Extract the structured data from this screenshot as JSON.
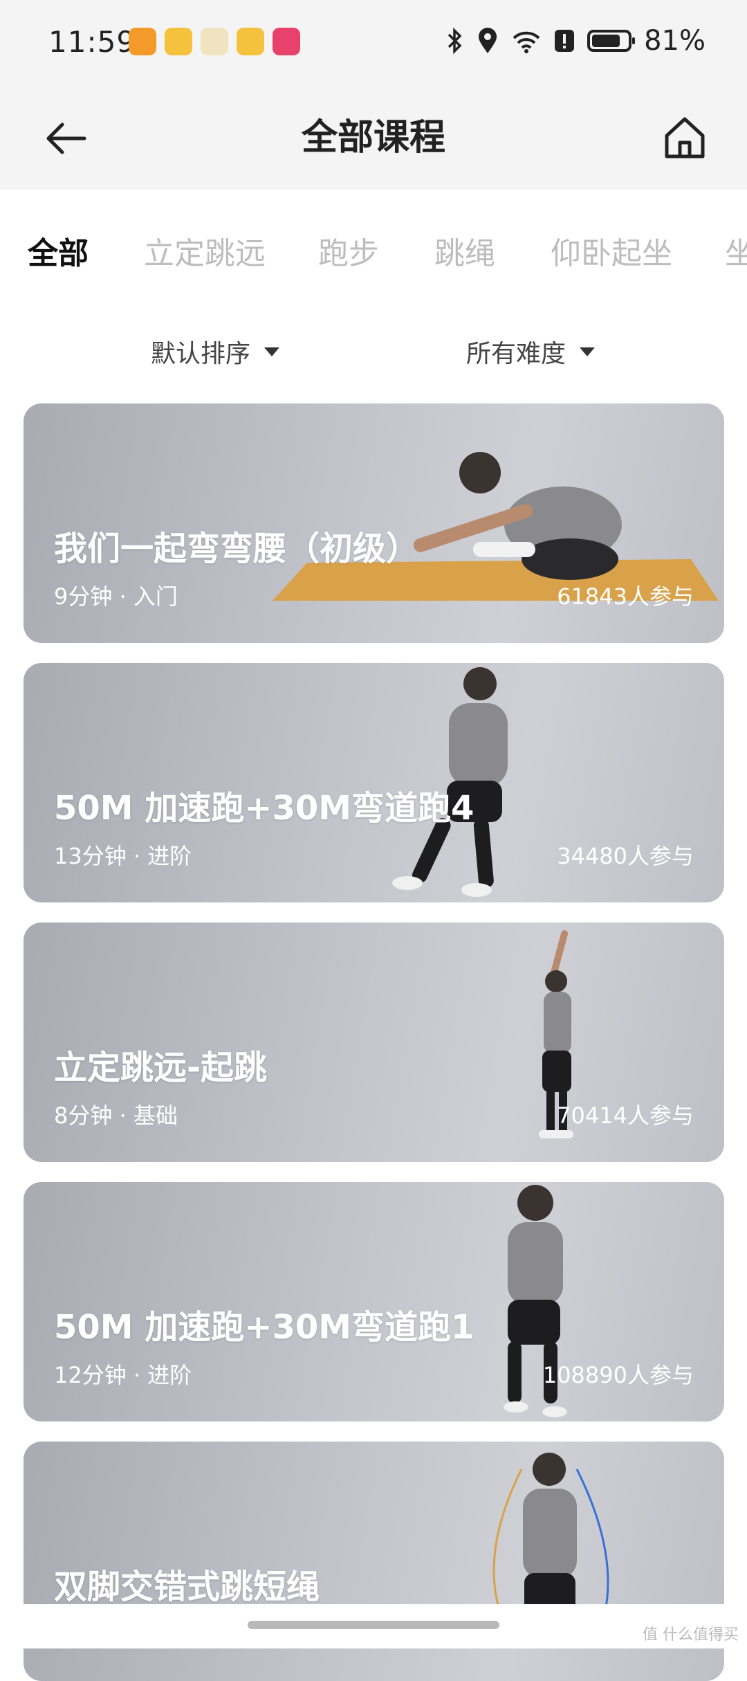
{
  "status": {
    "time": "11:59",
    "battery": "81%"
  },
  "header": {
    "title": "全部课程"
  },
  "tabs": [
    {
      "label": "全部",
      "active": true
    },
    {
      "label": "立定跳远",
      "active": false
    },
    {
      "label": "跑步",
      "active": false
    },
    {
      "label": "跳绳",
      "active": false
    },
    {
      "label": "仰卧起坐",
      "active": false
    },
    {
      "label": "坐",
      "active": false
    }
  ],
  "filters": {
    "sort_label": "默认排序",
    "difficulty_label": "所有难度"
  },
  "courses": [
    {
      "title": "我们一起弯弯腰（初级）",
      "meta": "9分钟 · 入门",
      "participants": "61843人参与"
    },
    {
      "title": "50M 加速跑+30M弯道跑4",
      "meta": "13分钟 · 进阶",
      "participants": "34480人参与"
    },
    {
      "title": "立定跳远-起跳",
      "meta": "8分钟 · 基础",
      "participants": "70414人参与"
    },
    {
      "title": "50M 加速跑+30M弯道跑1",
      "meta": "12分钟 · 进阶",
      "participants": "108890人参与"
    },
    {
      "title": "双脚交错式跳短绳",
      "meta": "",
      "participants": ""
    }
  ],
  "watermark": "值 什么值得买"
}
